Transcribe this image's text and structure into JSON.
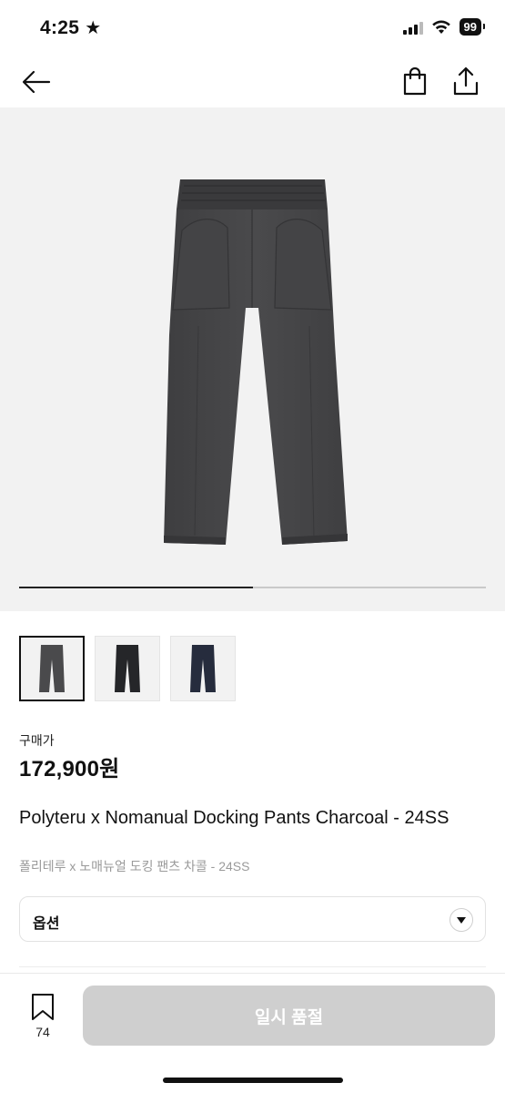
{
  "status_bar": {
    "time": "4:25",
    "time_icon": "star-icon",
    "battery": "99",
    "colors": {
      "text": "#111111"
    }
  },
  "nav": {
    "back_icon": "arrow-left-icon",
    "cart_icon": "shopping-bag-icon",
    "share_icon": "share-icon"
  },
  "gallery": {
    "progress": 0.5,
    "background": "#f2f2f2",
    "main_image": "charcoal-pants-image",
    "thumbnails": [
      {
        "name": "charcoal-pants-thumbnail",
        "color": "#4a4a4c",
        "selected": true
      },
      {
        "name": "black-pants-thumbnail",
        "color": "#252629",
        "selected": false
      },
      {
        "name": "navy-pants-thumbnail",
        "color": "#262c3d",
        "selected": false
      }
    ]
  },
  "price": {
    "label": "구매가",
    "value": "172,900원"
  },
  "product": {
    "title_en": "Polyteru x Nomanual Docking Pants Charcoal - 24SS",
    "title_ko": "폴리테루 x 노매뉴얼 도킹 팬츠 차콜 - 24SS"
  },
  "option": {
    "label": "옵션",
    "chevron_icon": "chevron-down-icon"
  },
  "bottom_bar": {
    "bookmark_icon": "bookmark-icon",
    "bookmark_count": "74",
    "button_label": "일시 품절",
    "button_color": "#cfcfcf"
  }
}
